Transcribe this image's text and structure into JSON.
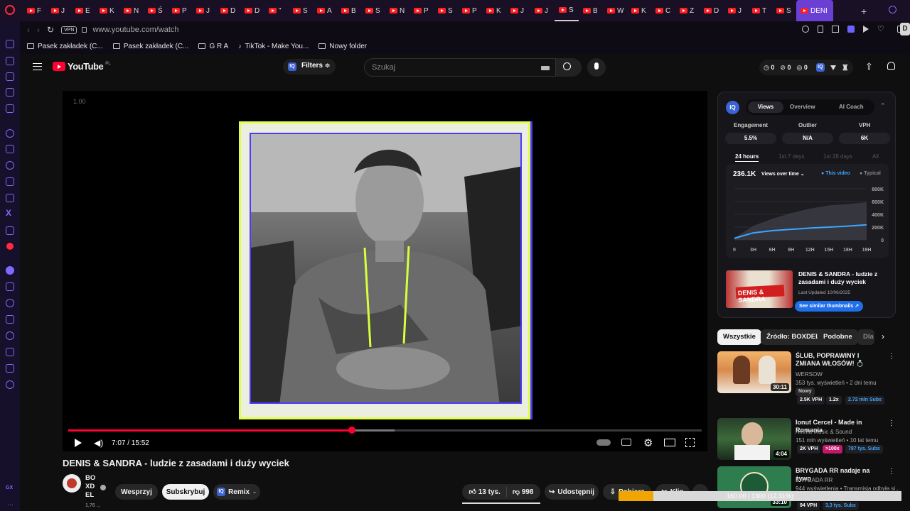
{
  "browser": {
    "tabs": [
      "F",
      "J",
      "E",
      "K",
      "N",
      "Ś",
      "P",
      "J",
      "D",
      "D",
      "\"",
      "S",
      "A",
      "B",
      "S",
      "N",
      "P",
      "S",
      "P",
      "K",
      "J",
      "J",
      "S",
      "B",
      "W",
      "K",
      "C",
      "Z",
      "D",
      "J",
      "T",
      "S"
    ],
    "active_tab": "DENI",
    "address": "www.youtube.com/watch",
    "vpn_label": "VPN",
    "bookmarks": [
      "Pasek zakładek (C...",
      "Pasek zakładek (C...",
      "G R A",
      "TikTok - Make You...",
      "Nowy folder"
    ],
    "sidebar_bottom": "GX",
    "profile_initial": "D"
  },
  "youtube": {
    "logo": "YouTube",
    "logo_region": "PL",
    "filters_label": "Filters",
    "search_placeholder": "Szukaj",
    "counters": [
      "0",
      "0",
      "0"
    ]
  },
  "player": {
    "speed": "1.00",
    "time": "7:07 / 15:52",
    "progress_fraction": 0.448,
    "buffered_fraction": 0.515
  },
  "video": {
    "title": "DENIS & SANDRA - ludzie z zasadami i duży wyciek",
    "channel_lines": [
      "BO",
      "XD",
      "EL"
    ],
    "channel_subs": "1,76 ...",
    "support_label": "Wesprzyj",
    "subscribe_label": "Subskrybuj",
    "remix_label": "Remix",
    "likes": "13 tys.",
    "dislikes": "998",
    "share_label": "Udostępnij",
    "download_label": "Pobierz",
    "clip_label": "Klip"
  },
  "vidiq": {
    "tabs": [
      "Views",
      "Overview",
      "AI Coach"
    ],
    "stat_labels": [
      "Engagement",
      "Outlier",
      "VPH"
    ],
    "stat_values": [
      "5.5%",
      "N/A",
      "6K"
    ],
    "ranges": [
      "24 hours",
      "1st 7 days",
      "1st 28 days",
      "All"
    ],
    "total_views": "236.1K",
    "views_dropdown": "Views over time",
    "legend": [
      "This video",
      "Typical"
    ],
    "colors": {
      "this_video": "#3ea6ff",
      "typical": "#555555",
      "accent": "#3b63d6"
    },
    "thumb_title": "DENIS & SANDRA - ludzie z zasadami i duży wyciek",
    "thumb_text": "DENIS & SANDRA",
    "last_updated": "Last Updated 10/06/2025",
    "similar_button": "See similar thumbnails"
  },
  "chart_data": {
    "type": "area",
    "x": [
      "0",
      "3H",
      "6H",
      "9H",
      "12H",
      "15H",
      "18H",
      "19H"
    ],
    "y_ticks": [
      "800K",
      "600K",
      "400K",
      "200K",
      "0"
    ],
    "ylim": [
      0,
      800000
    ],
    "series": [
      {
        "name": "This video",
        "values": [
          25000,
          110000,
          145000,
          165000,
          185000,
          200000,
          215000,
          236100
        ]
      },
      {
        "name": "Typical",
        "values": [
          30000,
          220000,
          330000,
          420000,
          490000,
          540000,
          560000,
          590000
        ]
      }
    ]
  },
  "chips": [
    "Wszystkie",
    "Źródło: BOXDEL",
    "Podobne",
    "Dla"
  ],
  "suggestions": [
    {
      "title": "ŚLUB, POPRAWINY I ZMIANA WŁOSÓW! 💍",
      "channel": "WERSOW",
      "meta": "353 tys. wyświetleń • 2 dni temu",
      "badge": "Nowy",
      "vph": "2.5K VPH",
      "mult": "1.2x",
      "subs": "2.72 mln Subs",
      "duration": "30:11"
    },
    {
      "title": "Ionut Cercel - Made in Romania",
      "channel": "Amma Music & Sound",
      "meta": "151 mln wyświetleń • 10 lat temu",
      "vph": "2K VPH",
      "mult": ">100x",
      "subs": "787 tys. Subs",
      "duration": "4:04"
    },
    {
      "title": "BRYGADA RR nadaje na żywo",
      "channel": "BRYGADA RR",
      "meta": "944 wyświetlenia • Transmisja odbyła si...",
      "vph": "94 VPH",
      "subs": "3,3 tys. Subs",
      "duration": "33:10"
    }
  ],
  "download": {
    "text": "160.00 / 1300 (12.31%)",
    "progress_fraction": 0.1231
  }
}
